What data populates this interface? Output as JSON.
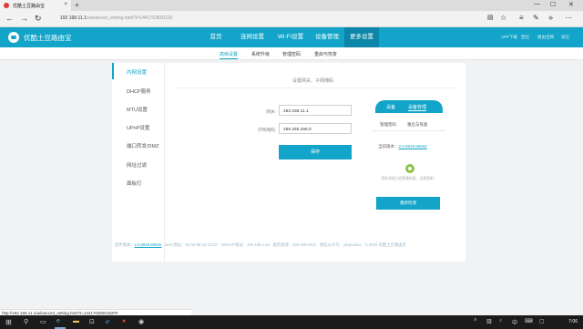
{
  "browser": {
    "tab_title": "优酷土豆路由宝",
    "tab_close": "×",
    "new_tab": "+",
    "win_minimize": "—",
    "win_maximize": "☐",
    "win_close": "✕",
    "url_host": "192.168.11.1",
    "url_path": "/advanced_setting.html?t=1441753600192",
    "status_url": "http://192.168.11.1/advanced_setting.html?t=1441753600192##"
  },
  "router": {
    "brand": "优酷土豆路由宝",
    "menu": [
      "首页",
      "连网设置",
      "Wi-Fi设置",
      "设备管理",
      "更多设置"
    ],
    "toplinks": [
      "APP下载",
      "登出",
      "路由宝网",
      "退出"
    ],
    "subnav": [
      "高级设置",
      "系统升级",
      "管理密码",
      "重启与恢复"
    ],
    "side": [
      "内网设置",
      "DHCP服务",
      "MTU设置",
      "UPnP设置",
      "端口转发/DMZ",
      "网址过滤",
      "面板灯"
    ],
    "content_tip": "设置网关、子网掩码",
    "gateway_label": "网关:",
    "gateway_value": "192.168.11.1",
    "mask_label": "子网掩码:",
    "mask_value": "255.255.255.0",
    "save": "保存"
  },
  "popup": {
    "tabs": [
      "设备",
      "设备管理"
    ],
    "subtabs": [
      "管理密码",
      "重启与恢复"
    ],
    "version_label": "当前版本：",
    "version_value": "2.0.0818.56932",
    "note": "您的系统已经是最新版，无需更新！",
    "button": "重新检测"
  },
  "footer": {
    "version_label": "固件版本：",
    "version_value": "2.0.0818.56932",
    "mac": "MAC地址：54:36:9B:18:13:D7",
    "wan": "WAN IP地址：192.168.1.64",
    "phone": "服务热线：400-405-8011",
    "wechat": "微信公众号：yfupoubao",
    "copyright": "© 2015 优酷土豆路由宝"
  },
  "taskbar": {
    "start": "⊞",
    "clock": "7:06"
  }
}
